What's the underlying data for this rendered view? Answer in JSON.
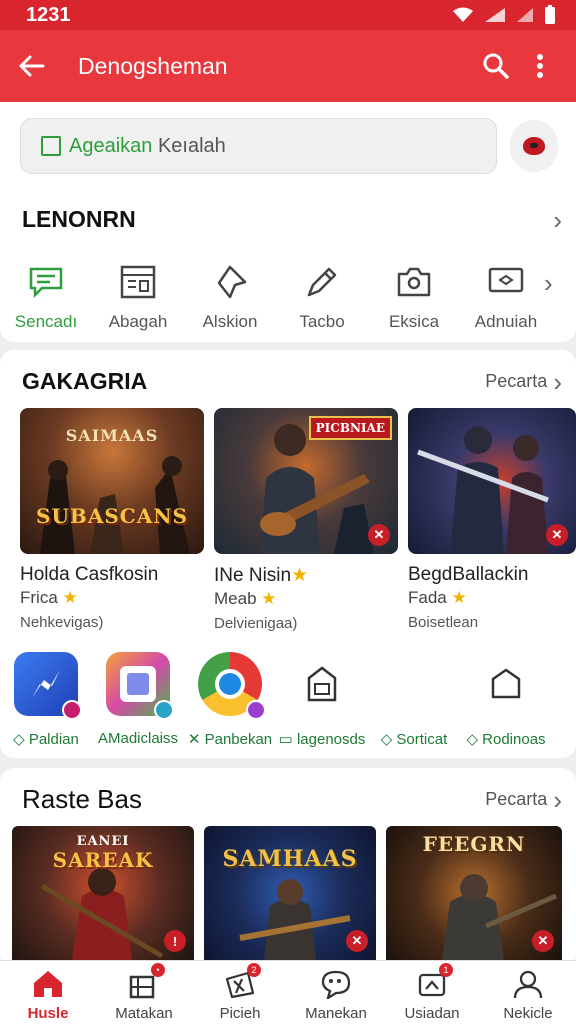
{
  "status_bar": {
    "time": "1231"
  },
  "app_bar": {
    "title": "Denogsheman"
  },
  "search": {
    "text_green": "Ageaikan",
    "text_gray": "Keıalah"
  },
  "categories_section": {
    "title": "LENONRN",
    "items": [
      {
        "label": "Sencadı",
        "icon": "chat-icon"
      },
      {
        "label": "Abagah",
        "icon": "calendar-icon"
      },
      {
        "label": "Alskion",
        "icon": "tag-icon"
      },
      {
        "label": "Tacbo",
        "icon": "pen-icon"
      },
      {
        "label": "Eksica",
        "icon": "camera-icon"
      },
      {
        "label": "Adnuiah",
        "icon": "ticket-icon"
      }
    ]
  },
  "games_section": {
    "title": "GAKAGRIA",
    "more": "Pecarta",
    "games": [
      {
        "art_title": "SUBASCANS",
        "art_top": "SAIMAAS",
        "name": "Holda Casfkosin",
        "sub": "Frica",
        "meta": "Nehkevigas)"
      },
      {
        "art_title": "PICBNIAE",
        "art_top": "",
        "name": "INe Nisin",
        "sub": "Meab",
        "meta": "Delvienigaa)"
      },
      {
        "art_title": "",
        "art_top": "",
        "name": "BegdBallackin",
        "sub": "Fada",
        "meta": "Boisetlean"
      }
    ],
    "apps": [
      {
        "label": "Paldian",
        "icon": "messenger-icon"
      },
      {
        "label": "AMadiclaiss",
        "icon": "gallery-icon"
      },
      {
        "label": "Panbekan",
        "icon": "chrome-icon"
      },
      {
        "label": "lagenosds",
        "icon": "shop-icon"
      },
      {
        "label": "Sorticat",
        "icon": "tag-icon"
      },
      {
        "label": "Rodinoas",
        "icon": "bookmark-icon"
      }
    ]
  },
  "second_section": {
    "title": "Raste Bas",
    "more": "Pecarta",
    "games": [
      {
        "art_title": "SAREAK",
        "art_top": "EANEI"
      },
      {
        "art_title": "SAMHAAS",
        "art_top": ""
      },
      {
        "art_title": "FEEGRN",
        "art_top": ""
      }
    ]
  },
  "bottom_nav": [
    {
      "label": "Husle",
      "icon": "home-icon"
    },
    {
      "label": "Matakan",
      "icon": "apps-icon"
    },
    {
      "label": "Picieh",
      "icon": "ticket-icon"
    },
    {
      "label": "Manekan",
      "icon": "chat-icon"
    },
    {
      "label": "Usiadan",
      "icon": "notification-icon"
    },
    {
      "label": "Nekicle",
      "icon": "profile-icon"
    }
  ],
  "colors": {
    "primary": "#e8373d",
    "accent_green": "#2e9e3c",
    "star": "#f0b400"
  }
}
